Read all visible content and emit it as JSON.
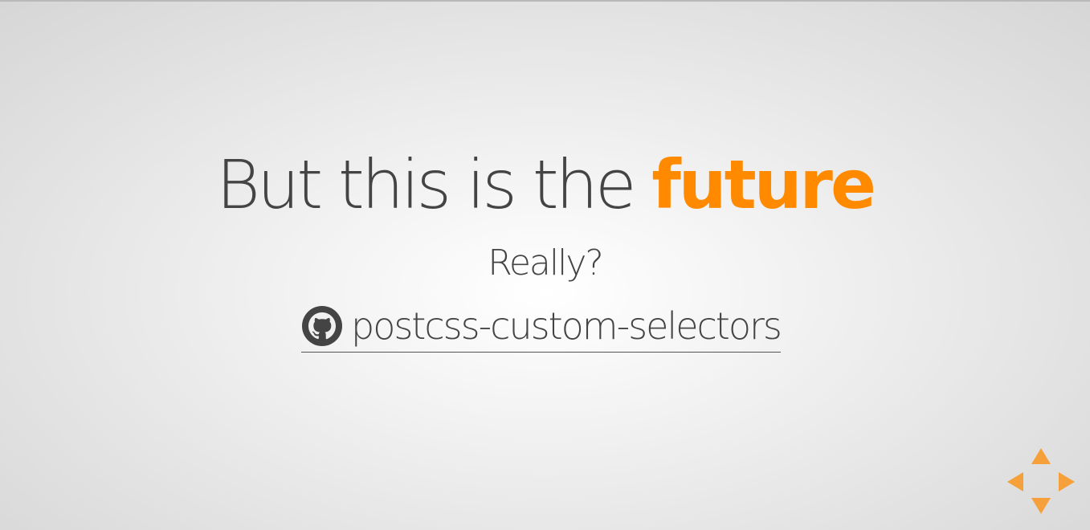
{
  "slide": {
    "title_prefix": "But this is the",
    "title_accent": "future",
    "subtitle": "Really?",
    "link": {
      "icon": "github-icon",
      "label": "postcss-custom-selectors"
    }
  },
  "controls": {
    "icons": [
      "arrow-up-icon",
      "arrow-left-icon",
      "arrow-right-icon",
      "arrow-down-icon"
    ]
  },
  "colors": {
    "accent": "#ff8a00",
    "text": "#444444",
    "controls": "#f5a03a"
  }
}
